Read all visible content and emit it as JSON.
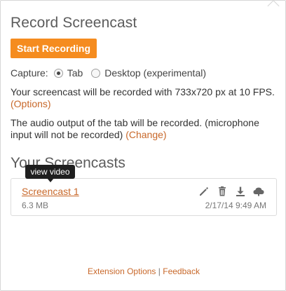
{
  "header": {
    "title": "Record Screencast"
  },
  "actions": {
    "start_label": "Start Recording"
  },
  "capture": {
    "label": "Capture:",
    "options": [
      {
        "label": "Tab",
        "selected": true
      },
      {
        "label": "Desktop (experimental)",
        "selected": false
      }
    ]
  },
  "info": {
    "resolution_text": "Your screencast will be recorded with 733x720 px at 10 FPS.",
    "options_link": "(Options)",
    "audio_text": "The audio output of the tab will be recorded. (microphone input will not be recorded)",
    "change_link": "(Change)"
  },
  "screencasts": {
    "title": "Your Screencasts",
    "tooltip": "view video",
    "items": [
      {
        "name": "Screencast 1",
        "size": "6.3 MB",
        "date": "2/17/14 9:49 AM"
      }
    ]
  },
  "footer": {
    "extension_options": "Extension Options",
    "separator": "|",
    "feedback": "Feedback"
  },
  "colors": {
    "accent": "#f58c1f",
    "link": "#c8682a",
    "text": "#333333",
    "muted": "#777777"
  },
  "icons": [
    "edit-icon",
    "trash-icon",
    "download-icon",
    "upload-icon"
  ]
}
